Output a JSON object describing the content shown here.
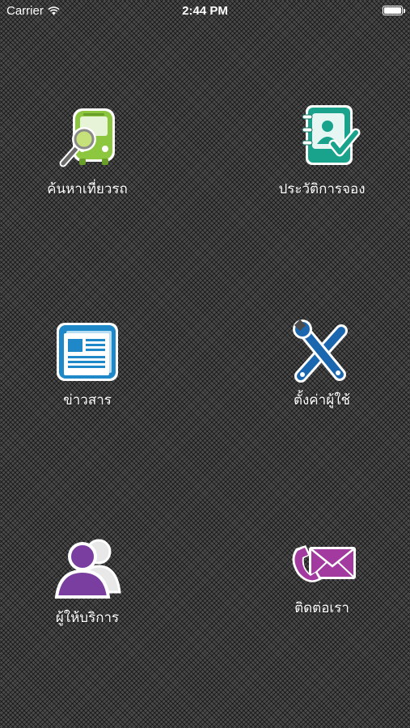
{
  "status_bar": {
    "carrier": "Carrier",
    "time": "2:44 PM",
    "battery_level": 1.0
  },
  "menu": [
    {
      "label": "ค้นหาเที่ยวรถ",
      "icon": "bus-search-icon",
      "color": "#8dc63f"
    },
    {
      "label": "ประวัติการจอง",
      "icon": "booking-history-icon",
      "color": "#1aa38c"
    },
    {
      "label": "ข่าวสาร",
      "icon": "newspaper-icon",
      "color": "#1e88c8"
    },
    {
      "label": "ตั้งค่าผู้ใช้",
      "icon": "wrench-screwdriver-icon",
      "color": "#1a67b0"
    },
    {
      "label": "ผู้ให้บริการ",
      "icon": "users-icon",
      "color": "#7a3ea0"
    },
    {
      "label": "ติดต่อเรา",
      "icon": "phone-mail-icon",
      "color": "#a33aa0"
    }
  ]
}
